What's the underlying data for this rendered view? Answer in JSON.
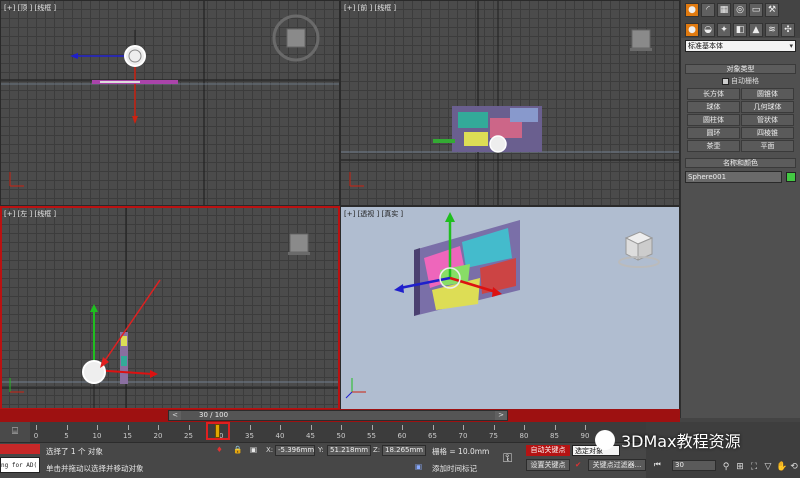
{
  "viewports": {
    "top": {
      "label": "[+] [顶 ] [线框 ]"
    },
    "front": {
      "label": "[+] [前 ] [线框 ]"
    },
    "left": {
      "label": "[+] [左 ] [线框 ]"
    },
    "perspective": {
      "label": "[+] [透视 ] [真实 ]",
      "viewcube_text": "左"
    }
  },
  "command_panel": {
    "category_dropdown": "标准基本体",
    "object_type": {
      "title": "对象类型",
      "autogrid_label": "自动栅格",
      "buttons": [
        "长方体",
        "圆锥体",
        "球体",
        "几何球体",
        "圆柱体",
        "管状体",
        "圆环",
        "四棱锥",
        "茶壶",
        "平面"
      ]
    },
    "name_color": {
      "title": "名称和颜色",
      "object_name": "Sphere001",
      "color": "#43c843"
    }
  },
  "time_slider": {
    "position_text": "30 / 100",
    "prev": "<",
    "next": ">"
  },
  "trackbar": {
    "ticks": [
      "0",
      "5",
      "10",
      "15",
      "20",
      "25",
      "30",
      "35",
      "40",
      "45",
      "50",
      "55",
      "60",
      "65",
      "70",
      "75",
      "80",
      "85",
      "90"
    ],
    "current_frame": 30
  },
  "status": {
    "script_text": "ng for AD(",
    "selected_text": "选择了 1 个 对象",
    "prompt_text": "单击并拖动以选择并移动对象",
    "x_label": "X:",
    "x_value": "-5.396mm",
    "y_label": "Y:",
    "y_value": "51.218mm",
    "z_label": "Z:",
    "z_value": "18.265mm",
    "grid_text": "栅格 = 10.0mm",
    "add_time_tag": "添加时间标记",
    "auto_key": "自动关键点",
    "selection_set": "选定对象",
    "set_key": "设置关键点",
    "key_filters": "关键点过滤器..."
  },
  "playback": {
    "frame": "30"
  },
  "watermark": {
    "text": "3DMax教程资源"
  },
  "colors": {
    "active_border": "#b11111",
    "auto_key_red": "#b51313",
    "accent_orange": "#e07a10"
  }
}
